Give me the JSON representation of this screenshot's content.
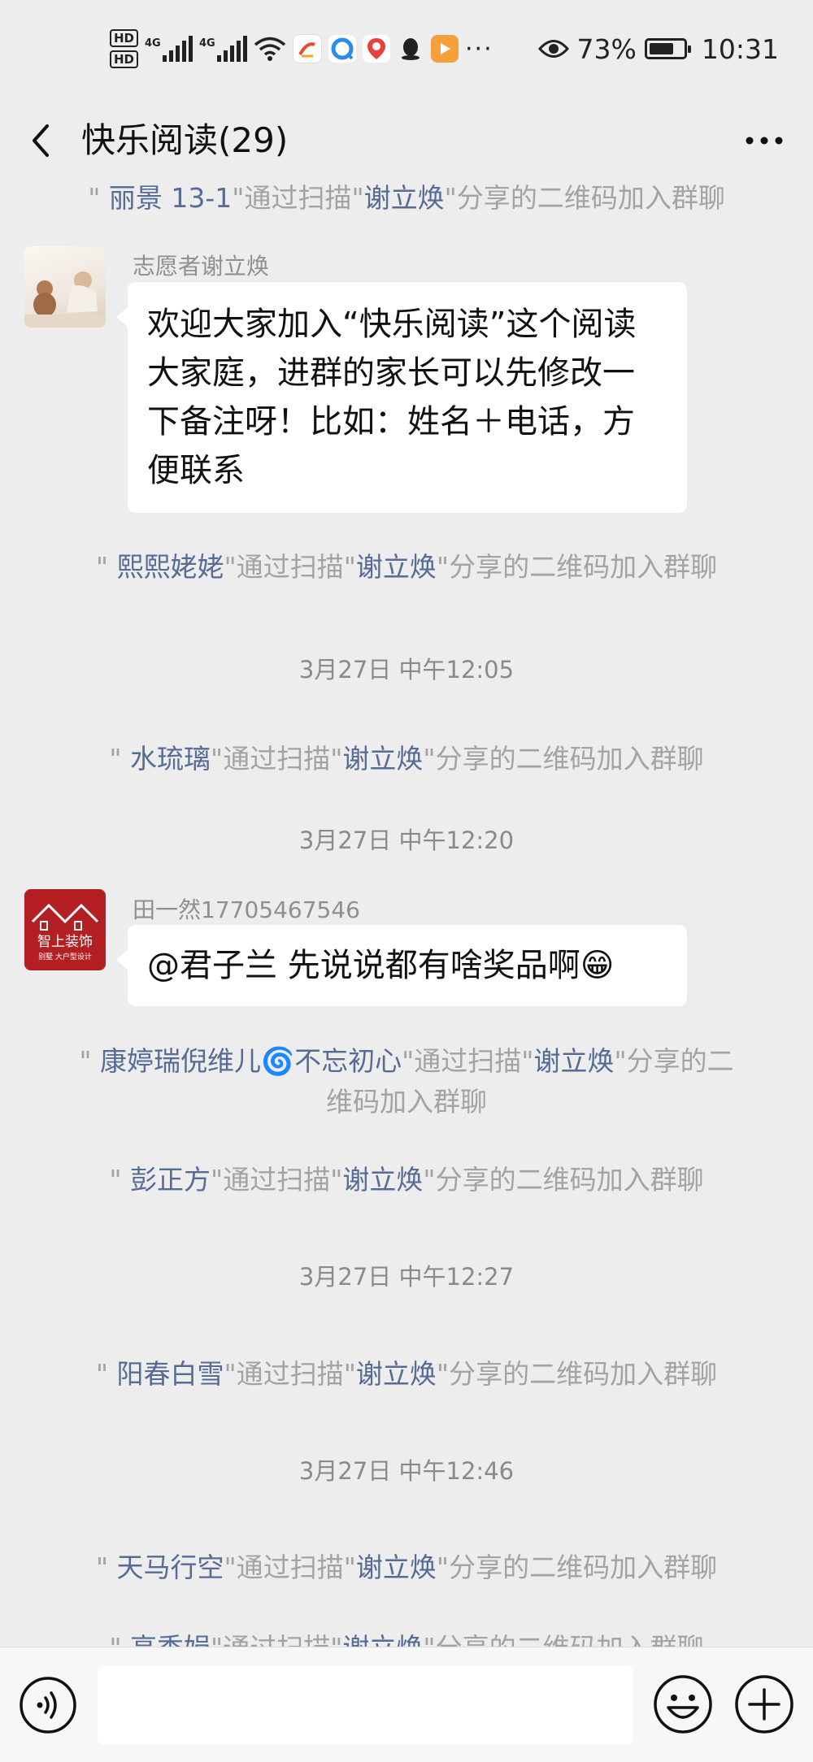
{
  "status_bar": {
    "hd1": "HD",
    "hd2": "HD",
    "net1": "4G",
    "net2": "4G",
    "more": "···",
    "battery": "73%",
    "battery_level": 0.73,
    "time": "10:31"
  },
  "header": {
    "title": "快乐阅读(29)"
  },
  "messages": {
    "join_1": {
      "name": "丽景 13-1",
      "mid": "通过扫描",
      "inviter": "谢立焕",
      "tail": "分享的二维码加入群聊"
    },
    "msg_1": {
      "sender": "志愿者谢立焕",
      "lines": [
        "欢迎大家加入“快乐阅读”这个阅读",
        "大家庭，进群的家长可以先修改一",
        "下备注呀！比如：姓名＋电话，方",
        "便联系"
      ]
    },
    "join_2": {
      "name": "熙熙姥姥",
      "mid": "通过扫描",
      "inviter": "谢立焕",
      "tail": "分享的二维码加入群聊"
    },
    "time_1": "3月27日 中午12:05",
    "join_3": {
      "name": "水琉璃",
      "mid": "通过扫描",
      "inviter": "谢立焕",
      "tail": "分享的二维码加入群聊"
    },
    "time_2": "3月27日 中午12:20",
    "msg_2": {
      "sender": "田一然17705467546",
      "text": "@君子兰  先说说都有啥奖品啊",
      "emoji": "😁",
      "avatar_line1": "智上装饰",
      "avatar_line2": "别墅  大户型设计"
    },
    "join_4": {
      "name": "康婷瑞倪维儿",
      "emoji": "🌀",
      "name2": "不忘初心",
      "mid": "通过扫描",
      "inviter": "谢立焕",
      "tail_line1": "分享的二",
      "tail_line2": "维码加入群聊"
    },
    "join_5": {
      "name": "彭正方",
      "mid": "通过扫描",
      "inviter": "谢立焕",
      "tail": "分享的二维码加入群聊"
    },
    "time_3": "3月27日 中午12:27",
    "join_6": {
      "name": "阳春白雪",
      "mid": "通过扫描",
      "inviter": "谢立焕",
      "tail": "分享的二维码加入群聊"
    },
    "time_4": "3月27日 中午12:46",
    "join_7": {
      "name": "天马行空",
      "mid": "通过扫描",
      "inviter": "谢立焕",
      "tail": "分享的二维码加入群聊"
    },
    "join_8": {
      "name": "高秀娟",
      "mid": "通过扫描",
      "inviter": "谢立焕",
      "tail": "分享的二维码加入群聊"
    }
  },
  "input_bar": {
    "value": "",
    "placeholder": ""
  },
  "icons": {
    "back": "chevron-left-icon",
    "more": "more-dots-icon",
    "voice": "voice-icon",
    "emoji": "emoji-icon",
    "plus": "plus-icon"
  },
  "colors": {
    "background": "#ededed",
    "name_link": "#576b95",
    "system_text": "#a3a3a3",
    "bubble": "#ffffff"
  }
}
